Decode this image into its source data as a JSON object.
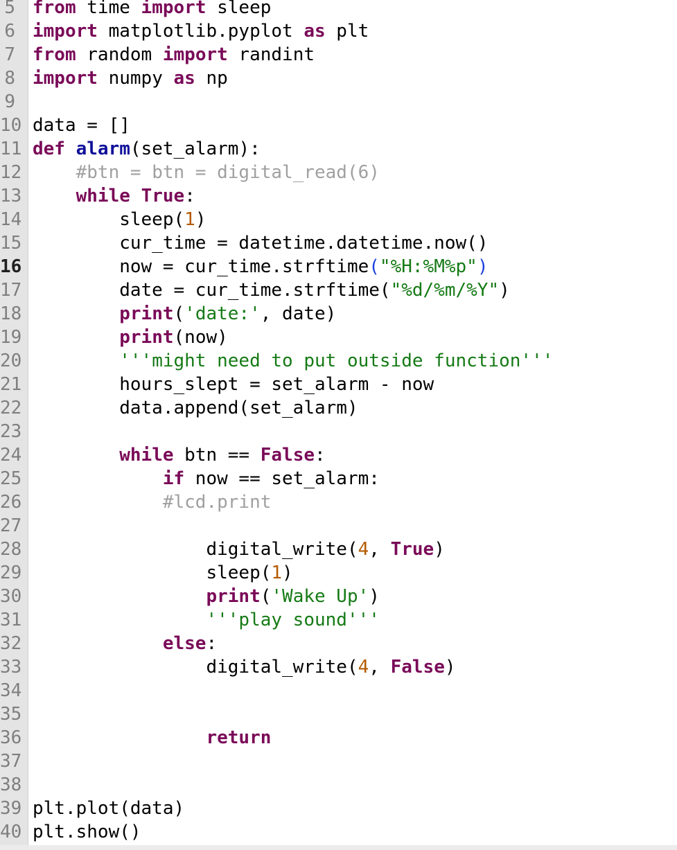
{
  "editor": {
    "current_line": "16",
    "lines": [
      {
        "num": "5",
        "tokens": [
          {
            "t": "kw",
            "v": "from"
          },
          {
            "t": "",
            "v": " time "
          },
          {
            "t": "kw",
            "v": "import"
          },
          {
            "t": "",
            "v": " sleep"
          }
        ]
      },
      {
        "num": "6",
        "tokens": [
          {
            "t": "kw",
            "v": "import"
          },
          {
            "t": "",
            "v": " matplotlib.pyplot "
          },
          {
            "t": "kw",
            "v": "as"
          },
          {
            "t": "",
            "v": " plt"
          }
        ]
      },
      {
        "num": "7",
        "tokens": [
          {
            "t": "kw",
            "v": "from"
          },
          {
            "t": "",
            "v": " random "
          },
          {
            "t": "kw",
            "v": "import"
          },
          {
            "t": "",
            "v": " randint"
          }
        ]
      },
      {
        "num": "8",
        "tokens": [
          {
            "t": "kw",
            "v": "import"
          },
          {
            "t": "",
            "v": " numpy "
          },
          {
            "t": "kw",
            "v": "as"
          },
          {
            "t": "",
            "v": " np"
          }
        ]
      },
      {
        "num": "9",
        "tokens": []
      },
      {
        "num": "10",
        "tokens": [
          {
            "t": "",
            "v": "data = []"
          }
        ]
      },
      {
        "num": "11",
        "tokens": [
          {
            "t": "kw",
            "v": "def"
          },
          {
            "t": "",
            "v": " "
          },
          {
            "t": "fn",
            "v": "alarm"
          },
          {
            "t": "",
            "v": "(set_alarm):"
          }
        ]
      },
      {
        "num": "12",
        "tokens": [
          {
            "t": "",
            "v": "    "
          },
          {
            "t": "cm",
            "v": "#btn = btn = digital_read(6)"
          }
        ]
      },
      {
        "num": "13",
        "tokens": [
          {
            "t": "",
            "v": "    "
          },
          {
            "t": "kw",
            "v": "while"
          },
          {
            "t": "",
            "v": " "
          },
          {
            "t": "kw",
            "v": "True"
          },
          {
            "t": "",
            "v": ":"
          }
        ]
      },
      {
        "num": "14",
        "tokens": [
          {
            "t": "",
            "v": "        sleep("
          },
          {
            "t": "nm",
            "v": "1"
          },
          {
            "t": "",
            "v": ")"
          }
        ]
      },
      {
        "num": "15",
        "tokens": [
          {
            "t": "",
            "v": "        cur_time = datetime.datetime.now()"
          }
        ]
      },
      {
        "num": "16",
        "tokens": [
          {
            "t": "",
            "v": "        now = cur_time.strftime"
          },
          {
            "t": "pm",
            "v": "("
          },
          {
            "t": "st",
            "v": "\"%H:%M%p\""
          },
          {
            "t": "pm",
            "v": ")"
          }
        ]
      },
      {
        "num": "17",
        "tokens": [
          {
            "t": "",
            "v": "        date = cur_time.strftime("
          },
          {
            "t": "st",
            "v": "\"%d/%m/%Y\""
          },
          {
            "t": "",
            "v": ")"
          }
        ]
      },
      {
        "num": "18",
        "tokens": [
          {
            "t": "",
            "v": "        "
          },
          {
            "t": "kw",
            "v": "print"
          },
          {
            "t": "",
            "v": "("
          },
          {
            "t": "st",
            "v": "'date:'"
          },
          {
            "t": "",
            "v": ", date)"
          }
        ]
      },
      {
        "num": "19",
        "tokens": [
          {
            "t": "",
            "v": "        "
          },
          {
            "t": "kw",
            "v": "print"
          },
          {
            "t": "",
            "v": "(now)"
          }
        ]
      },
      {
        "num": "20",
        "tokens": [
          {
            "t": "",
            "v": "        "
          },
          {
            "t": "st",
            "v": "'''might need to put outside function'''"
          }
        ]
      },
      {
        "num": "21",
        "tokens": [
          {
            "t": "",
            "v": "        hours_slept = set_alarm - now"
          }
        ]
      },
      {
        "num": "22",
        "tokens": [
          {
            "t": "",
            "v": "        data.append(set_alarm)"
          }
        ]
      },
      {
        "num": "23",
        "tokens": []
      },
      {
        "num": "24",
        "tokens": [
          {
            "t": "",
            "v": "        "
          },
          {
            "t": "kw",
            "v": "while"
          },
          {
            "t": "",
            "v": " btn == "
          },
          {
            "t": "kw",
            "v": "False"
          },
          {
            "t": "",
            "v": ":"
          }
        ]
      },
      {
        "num": "25",
        "tokens": [
          {
            "t": "",
            "v": "            "
          },
          {
            "t": "kw",
            "v": "if"
          },
          {
            "t": "",
            "v": " now == set_alarm:"
          }
        ]
      },
      {
        "num": "26",
        "tokens": [
          {
            "t": "",
            "v": "            "
          },
          {
            "t": "cm",
            "v": "#lcd.print"
          }
        ]
      },
      {
        "num": "27",
        "tokens": []
      },
      {
        "num": "28",
        "tokens": [
          {
            "t": "",
            "v": "                digital_write("
          },
          {
            "t": "nm",
            "v": "4"
          },
          {
            "t": "",
            "v": ", "
          },
          {
            "t": "kw",
            "v": "True"
          },
          {
            "t": "",
            "v": ")"
          }
        ]
      },
      {
        "num": "29",
        "tokens": [
          {
            "t": "",
            "v": "                sleep("
          },
          {
            "t": "nm",
            "v": "1"
          },
          {
            "t": "",
            "v": ")"
          }
        ]
      },
      {
        "num": "30",
        "tokens": [
          {
            "t": "",
            "v": "                "
          },
          {
            "t": "kw",
            "v": "print"
          },
          {
            "t": "",
            "v": "("
          },
          {
            "t": "st",
            "v": "'Wake Up'"
          },
          {
            "t": "",
            "v": ")"
          }
        ]
      },
      {
        "num": "31",
        "tokens": [
          {
            "t": "",
            "v": "                "
          },
          {
            "t": "st",
            "v": "'''play sound'''"
          }
        ]
      },
      {
        "num": "32",
        "tokens": [
          {
            "t": "",
            "v": "            "
          },
          {
            "t": "kw",
            "v": "else"
          },
          {
            "t": "",
            "v": ":"
          }
        ]
      },
      {
        "num": "33",
        "tokens": [
          {
            "t": "",
            "v": "                digital_write("
          },
          {
            "t": "nm",
            "v": "4"
          },
          {
            "t": "",
            "v": ", "
          },
          {
            "t": "kw",
            "v": "False"
          },
          {
            "t": "",
            "v": ")"
          }
        ]
      },
      {
        "num": "34",
        "tokens": []
      },
      {
        "num": "35",
        "tokens": []
      },
      {
        "num": "36",
        "tokens": [
          {
            "t": "",
            "v": "                "
          },
          {
            "t": "kw",
            "v": "return"
          }
        ]
      },
      {
        "num": "37",
        "tokens": []
      },
      {
        "num": "38",
        "tokens": []
      },
      {
        "num": "39",
        "tokens": [
          {
            "t": "",
            "v": "plt.plot(data)"
          }
        ]
      },
      {
        "num": "40",
        "tokens": [
          {
            "t": "",
            "v": "plt.show()"
          }
        ]
      }
    ]
  }
}
